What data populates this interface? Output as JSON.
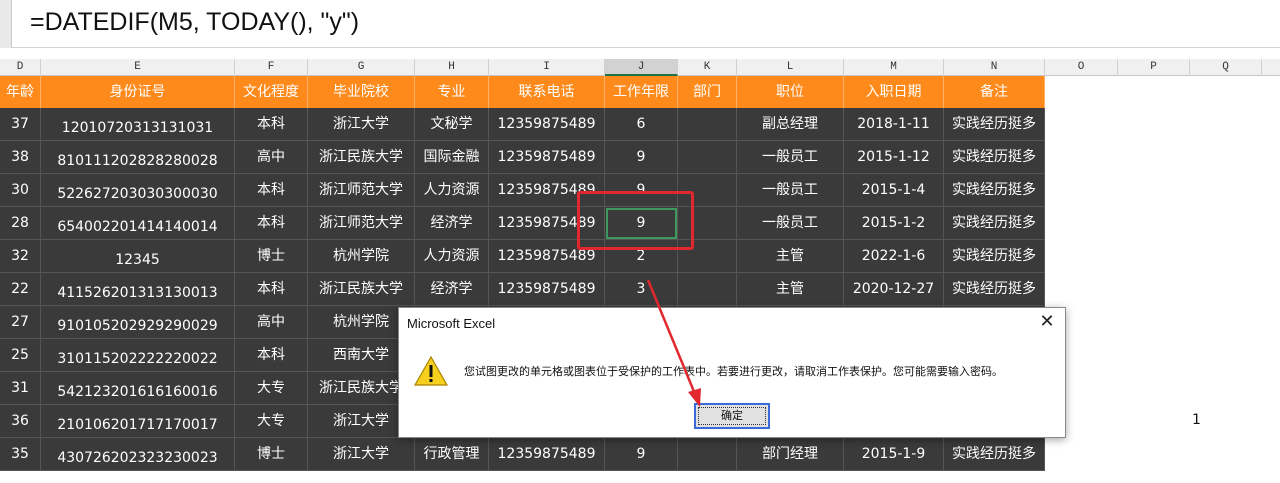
{
  "formula": "=DATEDIF(M5, TODAY(), \"y\")",
  "columns": [
    "D",
    "E",
    "F",
    "G",
    "H",
    "I",
    "J",
    "K",
    "L",
    "M",
    "N",
    "O",
    "P",
    "Q"
  ],
  "selected_column": "J",
  "headers": [
    "年龄",
    "身份证号",
    "文化程度",
    "毕业院校",
    "专业",
    "联系电话",
    "工作年限",
    "部门",
    "职位",
    "入职日期",
    "备注"
  ],
  "rows": [
    [
      "37",
      "12010720313131031",
      "本科",
      "浙江大学",
      "文秘学",
      "12359875489",
      "6",
      "",
      "副总经理",
      "2018-1-11",
      "实践经历挺多"
    ],
    [
      "38",
      "810111202828280028",
      "高中",
      "浙江民族大学",
      "国际金融",
      "12359875489",
      "9",
      "",
      "一般员工",
      "2015-1-12",
      "实践经历挺多"
    ],
    [
      "30",
      "522627203030300030",
      "本科",
      "浙江师范大学",
      "人力资源",
      "12359875489",
      "9",
      "",
      "一般员工",
      "2015-1-4",
      "实践经历挺多"
    ],
    [
      "28",
      "654002201414140014",
      "本科",
      "浙江师范大学",
      "经济学",
      "12359875489",
      "9",
      "",
      "一般员工",
      "2015-1-2",
      "实践经历挺多"
    ],
    [
      "32",
      "12345",
      "博士",
      "杭州学院",
      "人力资源",
      "12359875489",
      "2",
      "",
      "主管",
      "2022-1-6",
      "实践经历挺多"
    ],
    [
      "22",
      "411526201313130013",
      "本科",
      "浙江民族大学",
      "经济学",
      "12359875489",
      "3",
      "",
      "主管",
      "2020-12-27",
      "实践经历挺多"
    ],
    [
      "27",
      "910105202929290029",
      "高中",
      "杭州学院",
      "",
      "",
      "",
      "",
      "",
      "",
      ""
    ],
    [
      "25",
      "310115202222220022",
      "本科",
      "西南大学",
      "",
      "",
      "",
      "",
      "",
      "",
      ""
    ],
    [
      "31",
      "542123201616160016",
      "大专",
      "浙江民族大学",
      "",
      "",
      "",
      "",
      "",
      "",
      ""
    ],
    [
      "36",
      "210106201717170017",
      "大专",
      "浙江大学",
      "",
      "",
      "",
      "",
      "",
      "",
      ""
    ],
    [
      "35",
      "430726202323230023",
      "博士",
      "浙江大学",
      "行政管理",
      "12359875489",
      "9",
      "",
      "部门经理",
      "2015-1-9",
      "实践经历挺多"
    ]
  ],
  "active_row": 3,
  "stray_value": "1",
  "dialog": {
    "title": "Microsoft Excel",
    "message": "您试图更改的单元格或图表位于受保护的工作表中。若要进行更改，请取消工作表保护。您可能需要输入密码。",
    "ok_label": "确定",
    "close_icon": "close-icon",
    "warning_icon": "warning-icon"
  },
  "colors": {
    "header_bg": "#ff8a1c",
    "cell_bg": "#3a3a3a",
    "annotation_red": "#e2272e",
    "active_cell": "#3c9a5f"
  }
}
